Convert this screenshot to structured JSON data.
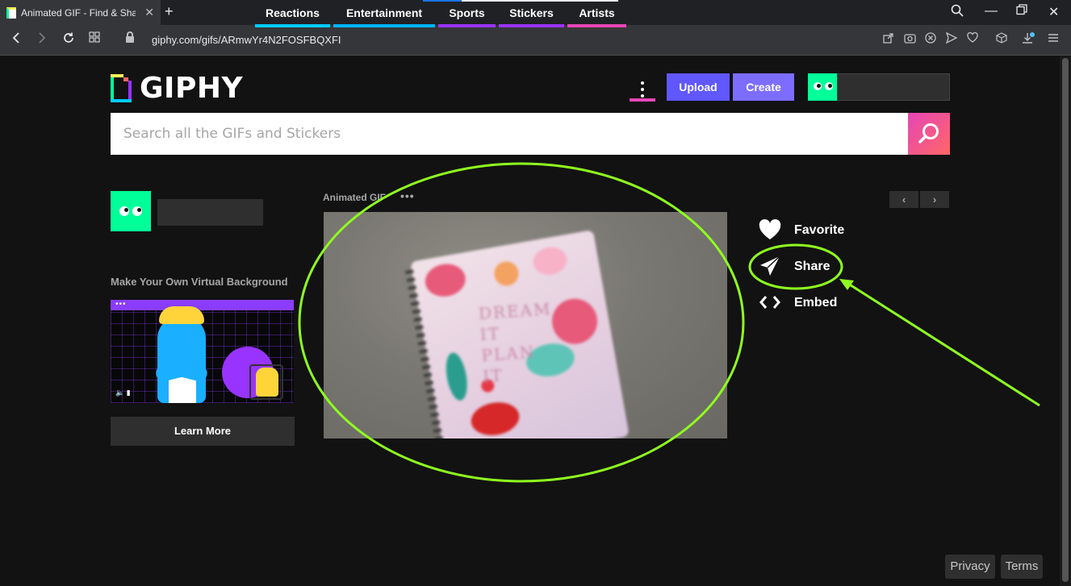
{
  "browser": {
    "tab_title": "Animated GIF - Find & Share on GIPHY",
    "url": "giphy.com/gifs/ARmwYr4N2FOSFBQXFI"
  },
  "header": {
    "logo_text": "GIPHY",
    "nav": [
      {
        "label": "Reactions",
        "color": "#00ccff"
      },
      {
        "label": "Entertainment",
        "color": "#00b3ff"
      },
      {
        "label": "Sports",
        "color": "#9933ff"
      },
      {
        "label": "Stickers",
        "color": "#9933ff"
      },
      {
        "label": "Artists",
        "color": "#e646b6"
      }
    ],
    "more_color": "#e646b6",
    "upload_label": "Upload",
    "create_label": "Create"
  },
  "search": {
    "placeholder": "Search all the GIFs and Stickers",
    "value": ""
  },
  "sidebar": {
    "virtual_bg_title": "Make Your Own Virtual Background",
    "learn_more_label": "Learn More"
  },
  "gif": {
    "label": "Animated GIF",
    "more": "•••",
    "notebook_text": "DREAM IT PLAN IT"
  },
  "actions": {
    "favorite_label": "Favorite",
    "share_label": "Share",
    "embed_label": "Embed"
  },
  "pager": {
    "prev": "‹",
    "next": "›"
  },
  "footer": {
    "privacy_label": "Privacy",
    "terms_label": "Terms"
  },
  "colors": {
    "annotation": "#8fff1f",
    "accent": "#6157ff",
    "brand_green": "#00ff99"
  }
}
